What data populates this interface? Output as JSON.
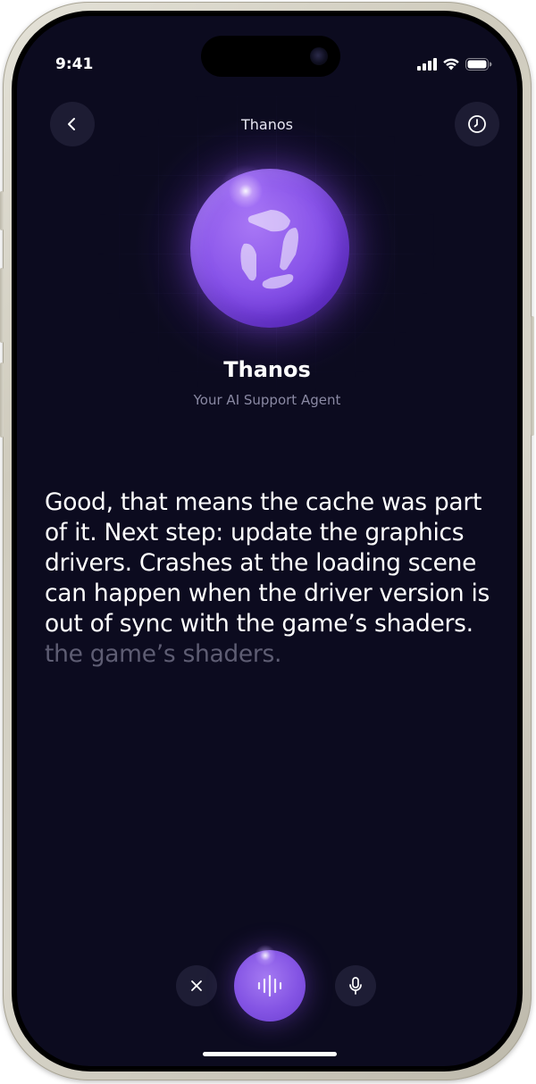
{
  "status_bar": {
    "time": "9:41",
    "icons": [
      "signal-icon",
      "wifi-icon",
      "battery-icon"
    ]
  },
  "header": {
    "title": "Thanos",
    "back_icon": "chevron-left-icon",
    "history_icon": "clock-icon"
  },
  "agent": {
    "name": "Thanos",
    "role": "Your AI Support Agent",
    "logo_icon": "agent-logo-icon"
  },
  "transcript": {
    "spoken_text": "Good, that means the cache was part of it. Next step: update the graphics drivers. Crashes at the loading scene can happen when the driver version is out of sync with the game’s shaders.",
    "pending_text": "the game’s shaders."
  },
  "controls": {
    "close_icon": "close-icon",
    "voice_icon": "waveform-icon",
    "mic_icon": "microphone-icon"
  },
  "colors": {
    "background": "#0c0b1f",
    "accent": "#8454e4",
    "text_primary": "#ffffff",
    "text_secondary": "#8a89a3",
    "text_faded": "#5e5d73"
  }
}
